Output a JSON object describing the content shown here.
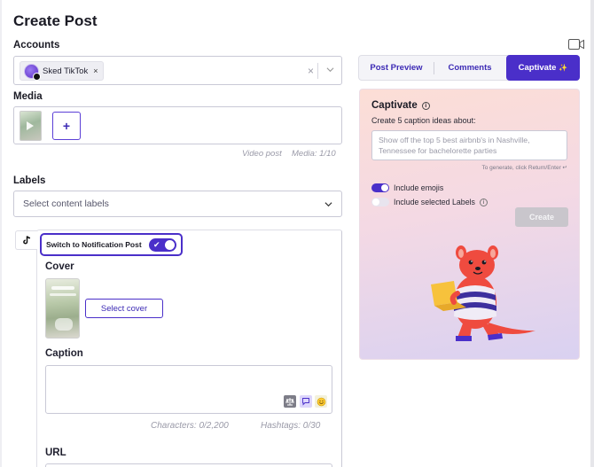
{
  "page": {
    "title": "Create Post"
  },
  "accounts": {
    "label": "Accounts",
    "selected": [
      {
        "name": "Sked TikTok",
        "remove": "×"
      }
    ],
    "clear": "×"
  },
  "media": {
    "label": "Media",
    "add": "+",
    "type_text": "Video post",
    "count_text": "Media: 1/10"
  },
  "labels": {
    "label": "Labels",
    "placeholder": "Select content labels"
  },
  "tiktok": {
    "notification_toggle_label": "Switch to Notification Post",
    "notification_toggle_check": "✔",
    "cover_label": "Cover",
    "select_cover": "Select cover",
    "caption_label": "Caption",
    "characters": "Characters: 0/2,200",
    "hashtags": "Hashtags: 0/30",
    "url_label": "URL"
  },
  "tabs": [
    {
      "label": "Post Preview"
    },
    {
      "label": "Comments"
    },
    {
      "label": "Captivate",
      "sparkle": "✨"
    }
  ],
  "captivate": {
    "title": "Captivate",
    "info": "i",
    "subtitle": "Create 5 caption ideas about:",
    "placeholder": "Show off the top 5 best airbnb's in Nashville, Tennessee for bachelorette parties",
    "hint": "To generate, click Return/Enter ↵",
    "include_emojis": "Include emojis",
    "include_labels": "Include selected Labels",
    "create": "Create"
  },
  "colors": {
    "accent": "#4a2fc9",
    "card_gradient_start": "#fcded6",
    "card_gradient_end": "#d9d1f1"
  },
  "icons": [
    "camera-icon",
    "tiktok-icon",
    "chevron-down-icon",
    "info-icon",
    "scale-icon",
    "chat-icon",
    "emoji-icon",
    "sparkle-icon"
  ]
}
